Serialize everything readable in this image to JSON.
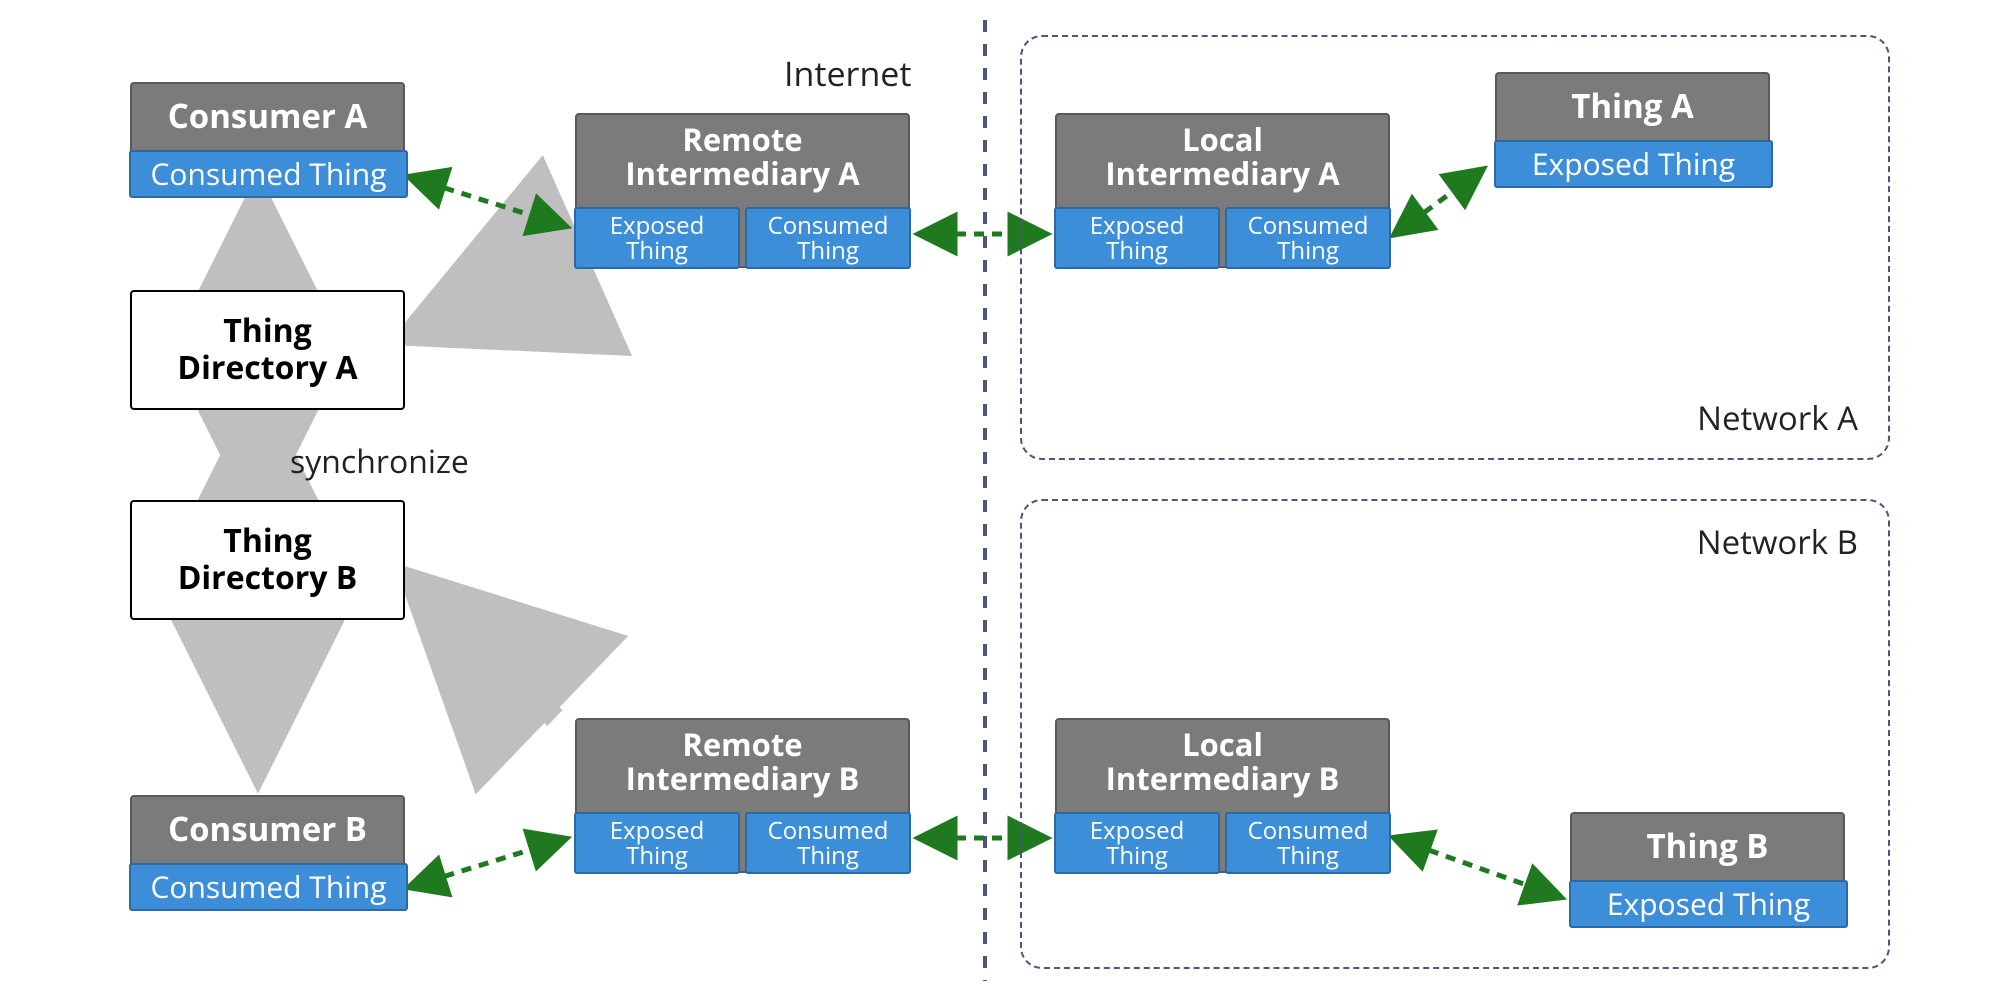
{
  "labels": {
    "internet": "Internet",
    "synchronize": "synchronize"
  },
  "regions": {
    "network_a": "Network A",
    "network_b": "Network B"
  },
  "directories": {
    "a": "Thing\nDirectory A",
    "b": "Thing\nDirectory B"
  },
  "consumers": {
    "a": {
      "title": "Consumer A",
      "chip": "Consumed Thing"
    },
    "b": {
      "title": "Consumer B",
      "chip": "Consumed Thing"
    }
  },
  "remote_intermediaries": {
    "a": {
      "title": "Remote\nIntermediary A",
      "exposed": "Exposed\nThing",
      "consumed": "Consumed\nThing"
    },
    "b": {
      "title": "Remote\nIntermediary B",
      "exposed": "Exposed\nThing",
      "consumed": "Consumed\nThing"
    }
  },
  "local_intermediaries": {
    "a": {
      "title": "Local\nIntermediary A",
      "exposed": "Exposed\nThing",
      "consumed": "Consumed\nThing"
    },
    "b": {
      "title": "Local\nIntermediary B",
      "exposed": "Exposed\nThing",
      "consumed": "Consumed\nThing"
    }
  },
  "things": {
    "a": {
      "title": "Thing A",
      "chip": "Exposed Thing"
    },
    "b": {
      "title": "Thing B",
      "chip": "Exposed Thing"
    }
  },
  "chart_data": {
    "type": "diagram",
    "title": "WoT Intermediary Architecture",
    "zones": [
      {
        "id": "internet",
        "label": "Internet"
      },
      {
        "id": "network_a",
        "label": "Network A"
      },
      {
        "id": "network_b",
        "label": "Network B"
      }
    ],
    "nodes": [
      {
        "id": "consumer_a",
        "label": "Consumer A",
        "zone": "internet",
        "ports": [
          "Consumed Thing"
        ]
      },
      {
        "id": "consumer_b",
        "label": "Consumer B",
        "zone": "internet",
        "ports": [
          "Consumed Thing"
        ]
      },
      {
        "id": "dir_a",
        "label": "Thing Directory A",
        "zone": "internet",
        "ports": []
      },
      {
        "id": "dir_b",
        "label": "Thing Directory B",
        "zone": "internet",
        "ports": []
      },
      {
        "id": "remote_a",
        "label": "Remote Intermediary A",
        "zone": "internet",
        "ports": [
          "Exposed Thing",
          "Consumed Thing"
        ]
      },
      {
        "id": "remote_b",
        "label": "Remote Intermediary B",
        "zone": "internet",
        "ports": [
          "Exposed Thing",
          "Consumed Thing"
        ]
      },
      {
        "id": "local_a",
        "label": "Local Intermediary A",
        "zone": "network_a",
        "ports": [
          "Exposed Thing",
          "Consumed Thing"
        ]
      },
      {
        "id": "local_b",
        "label": "Local Intermediary B",
        "zone": "network_b",
        "ports": [
          "Exposed Thing",
          "Consumed Thing"
        ]
      },
      {
        "id": "thing_a",
        "label": "Thing A",
        "zone": "network_a",
        "ports": [
          "Exposed Thing"
        ]
      },
      {
        "id": "thing_b",
        "label": "Thing B",
        "zone": "network_b",
        "ports": [
          "Exposed Thing"
        ]
      }
    ],
    "edges": [
      {
        "from": "consumer_a",
        "to": "remote_a",
        "style": "green-dashed-bidir"
      },
      {
        "from": "remote_a",
        "to": "local_a",
        "style": "green-dashed-bidir"
      },
      {
        "from": "local_a",
        "to": "thing_a",
        "style": "green-dashed-bidir"
      },
      {
        "from": "consumer_b",
        "to": "remote_b",
        "style": "green-dashed-bidir"
      },
      {
        "from": "remote_b",
        "to": "local_b",
        "style": "green-dashed-bidir"
      },
      {
        "from": "local_b",
        "to": "thing_b",
        "style": "green-dashed-bidir"
      },
      {
        "from": "dir_a",
        "to": "consumer_a",
        "style": "gray-solid-arrow"
      },
      {
        "from": "remote_a",
        "to": "dir_a",
        "style": "gray-solid-arrow"
      },
      {
        "from": "dir_b",
        "to": "consumer_b",
        "style": "gray-solid-arrow"
      },
      {
        "from": "remote_b",
        "to": "dir_b",
        "style": "gray-solid-arrow"
      },
      {
        "from": "dir_a",
        "to": "dir_b",
        "style": "gray-solid-bidir",
        "label": "synchronize"
      }
    ]
  }
}
